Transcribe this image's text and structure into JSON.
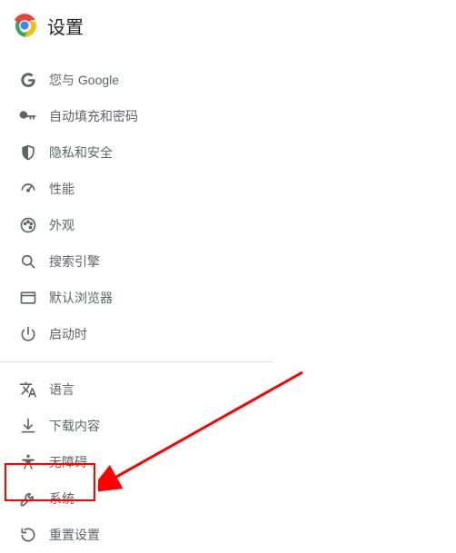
{
  "header": {
    "title": "设置"
  },
  "nav": {
    "group1": [
      {
        "id": "you-and-google",
        "icon": "google-g",
        "label": "您与 Google"
      },
      {
        "id": "autofill",
        "icon": "key",
        "label": "自动填充和密码"
      },
      {
        "id": "privacy",
        "icon": "shield",
        "label": "隐私和安全"
      },
      {
        "id": "performance",
        "icon": "speedometer",
        "label": "性能"
      },
      {
        "id": "appearance",
        "icon": "palette",
        "label": "外观"
      },
      {
        "id": "search-engine",
        "icon": "search",
        "label": "搜索引擎"
      },
      {
        "id": "default-browser",
        "icon": "browser",
        "label": "默认浏览器"
      },
      {
        "id": "on-startup",
        "icon": "power",
        "label": "启动时"
      }
    ],
    "group2": [
      {
        "id": "languages",
        "icon": "translate",
        "label": "语言"
      },
      {
        "id": "downloads",
        "icon": "download",
        "label": "下载内容"
      },
      {
        "id": "accessibility",
        "icon": "accessibility",
        "label": "无障碍"
      },
      {
        "id": "system",
        "icon": "wrench",
        "label": "系统"
      },
      {
        "id": "reset",
        "icon": "reset",
        "label": "重置设置"
      }
    ]
  },
  "annotation": {
    "highlighted_item": "system",
    "arrow_color": "#ff0000"
  }
}
